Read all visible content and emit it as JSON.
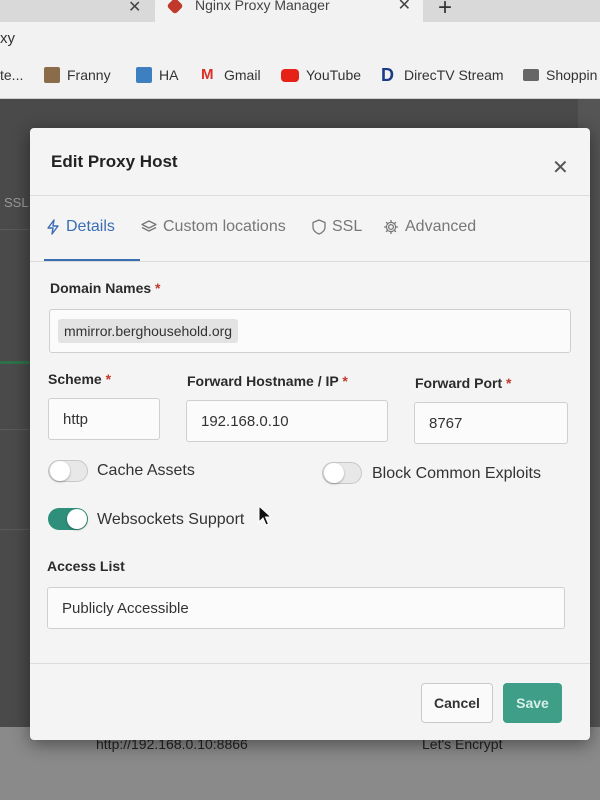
{
  "browser": {
    "active_tab_title": "Nginx Proxy Manager",
    "url_fragment": "xy",
    "bookmarks": [
      {
        "label": "te...",
        "icon": "bookmark-icon"
      },
      {
        "label": "Franny",
        "icon": "photo-icon"
      },
      {
        "label": "HA",
        "icon": "home-assistant-icon"
      },
      {
        "label": "Gmail",
        "icon": "gmail-icon"
      },
      {
        "label": "YouTube",
        "icon": "youtube-icon"
      },
      {
        "label": "DirecTV Stream",
        "icon": "directv-icon"
      },
      {
        "label": "Shoppin",
        "icon": "folder-icon"
      }
    ]
  },
  "background_page": {
    "ssl_fragment": "SSL",
    "row_url": "http://192.168.0.10:8866",
    "row_ssl": "Let's Encrypt"
  },
  "modal": {
    "title": "Edit Proxy Host",
    "tabs": [
      {
        "label": "Details",
        "icon": "bolt-icon",
        "active": true
      },
      {
        "label": "Custom locations",
        "icon": "layers-icon",
        "active": false
      },
      {
        "label": "SSL",
        "icon": "shield-icon",
        "active": false
      },
      {
        "label": "Advanced",
        "icon": "gear-icon",
        "active": false
      }
    ],
    "domain_names": {
      "label": "Domain Names",
      "required_mark": "*",
      "chip": "mmirror.berghousehold.org"
    },
    "scheme": {
      "label": "Scheme",
      "required_mark": "*",
      "value": "http"
    },
    "forward_hostname": {
      "label": "Forward Hostname / IP",
      "required_mark": "*",
      "value": "192.168.0.10"
    },
    "forward_port": {
      "label": "Forward Port",
      "required_mark": "*",
      "value": "8767"
    },
    "toggles": {
      "cache_assets": {
        "label": "Cache Assets",
        "on": false
      },
      "block_exploits": {
        "label": "Block Common Exploits",
        "on": false
      },
      "websockets": {
        "label": "Websockets Support",
        "on": true
      }
    },
    "access_list": {
      "label": "Access List",
      "value": "Publicly Accessible"
    },
    "buttons": {
      "cancel": "Cancel",
      "save": "Save"
    }
  },
  "colors": {
    "accent_blue": "#3b6db3",
    "toggle_on": "#2e8f7a",
    "save_button": "#3e9e87",
    "required": "#c0392b"
  }
}
